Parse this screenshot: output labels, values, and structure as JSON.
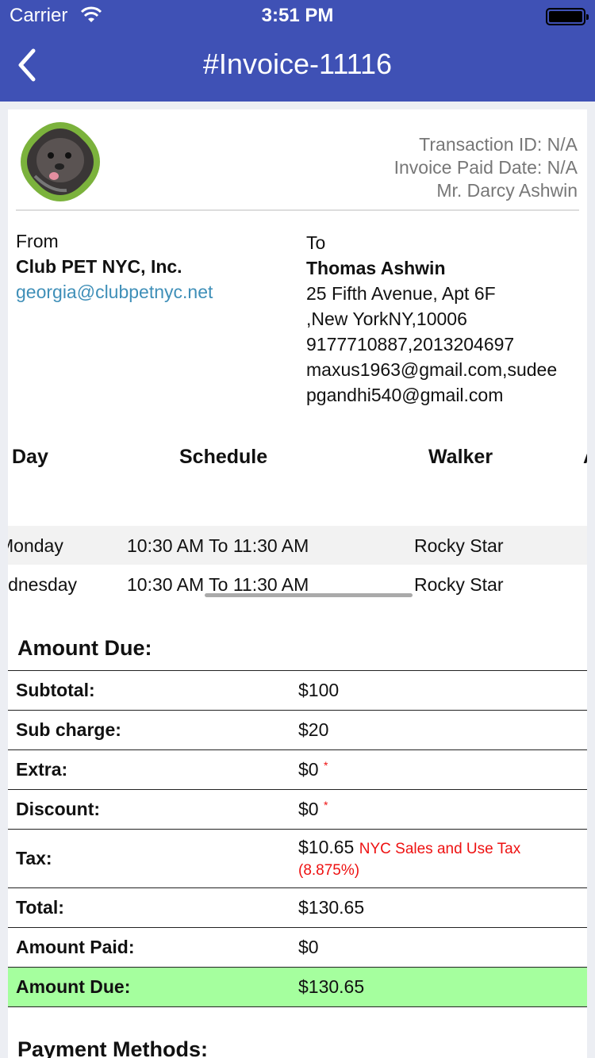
{
  "status_bar": {
    "carrier": "Carrier",
    "time": "3:51 PM"
  },
  "nav": {
    "title": "#Invoice-11116"
  },
  "invoice_meta": {
    "transaction_id": "Transaction ID: N/A",
    "paid_date": "Invoice Paid Date: N/A",
    "customer": "Mr. Darcy Ashwin"
  },
  "from": {
    "label": "From",
    "name": "Club PET NYC, Inc.",
    "email": "georgia@clubpetnyc.net"
  },
  "to": {
    "label": "To",
    "name": "Thomas Ashwin",
    "address1": "25 Fifth Avenue, Apt 6F",
    "address2": ",New YorkNY,10006",
    "phones": "9177710887,2013204697",
    "email1": "maxus1963@gmail.com,sudee",
    "email2": "pgandhi540@gmail.com"
  },
  "schedule": {
    "headers": {
      "day": "Day",
      "schedule": "Schedule",
      "walker": "Walker",
      "extra": "A"
    },
    "rows": [
      {
        "day": "Monday",
        "time": "10:30 AM To 11:30 AM",
        "walker": "Rocky Star"
      },
      {
        "day": "Wednesday",
        "time": "10:30 AM To 11:30 AM",
        "walker": "Rocky Star"
      }
    ]
  },
  "amount_due_title": "Amount Due:",
  "amounts": {
    "subtotal": {
      "label": "Subtotal:",
      "value": "$100"
    },
    "sub_charge": {
      "label": "Sub charge:",
      "value": "$20"
    },
    "extra": {
      "label": "Extra:",
      "value": "$0"
    },
    "discount": {
      "label": "Discount:",
      "value": "$0"
    },
    "tax": {
      "label": "Tax:",
      "value": "$10.65",
      "note1": "NYC Sales and Use Tax",
      "note2": "(8.875%)"
    },
    "total": {
      "label": "Total:",
      "value": "$130.65"
    },
    "paid": {
      "label": "Amount Paid:",
      "value": "$0"
    },
    "due": {
      "label": "Amount Due:",
      "value": "$130.65"
    }
  },
  "payment_methods_title": "Payment Methods:",
  "colors": {
    "nav": "#3f51b5",
    "due_highlight": "#a5ff9e",
    "link": "#3f8fb8",
    "required": "#ee1111"
  }
}
